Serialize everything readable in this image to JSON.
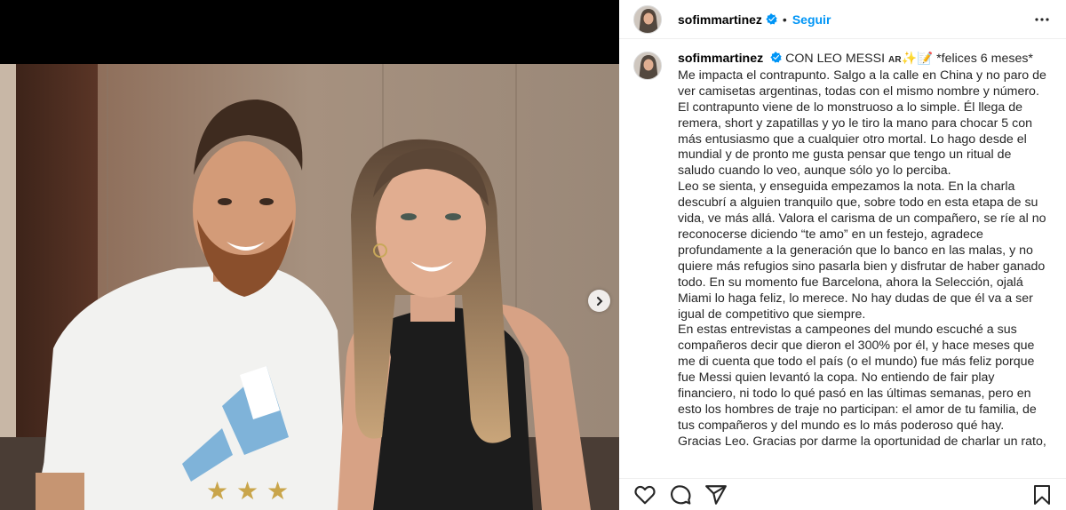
{
  "post": {
    "username": "sofimmartinez",
    "follow_label": "Seguir",
    "separator": "•",
    "caption_head": "CON LEO MESSI",
    "flag_text": "AR",
    "emoji": "✨📝",
    "caption_tail": " *felices 6 meses*",
    "paragraphs": [
      "Me impacta el contrapunto. Salgo a la calle en China y no paro de ver camisetas argentinas, todas con el mismo nombre y número.",
      "El contrapunto viene de lo monstruoso a lo simple. Él llega de remera, short y zapatillas y yo le tiro la mano para chocar 5 con más entusiasmo que a cualquier otro mortal. Lo hago desde el mundial y de pronto me gusta pensar que tengo un ritual de saludo cuando lo veo, aunque sólo yo lo perciba.",
      "Leo se sienta, y enseguida empezamos la nota. En la charla descubrí a alguien tranquilo que, sobre todo en esta etapa de su vida, ve más allá. Valora el carisma de un compañero, se ríe al no reconocerse diciendo “te amo” en un festejo, agradece profundamente a la generación que lo banco en las malas, y no quiere más refugios sino pasarla bien y disfrutar de haber ganado todo. En su momento fue Barcelona, ahora la Selección, ojalá Miami lo haga feliz, lo merece. No hay dudas de que él va a ser igual de competitivo que siempre.",
      "En estas entrevistas a campeones del mundo escuché a sus compañeros decir que dieron el 300% por él, y hace meses que me di cuenta que todo el país (o el mundo) fue más feliz porque fue Messi quien levantó la copa. No entiendo de fair play financiero, ni todo lo qué pasó en las últimas semanas, pero en esto los hombres de traje no participan: el amor de tu familia, de tus compañeros y del mundo es lo más poderoso qué hay.",
      "Gracias Leo. Gracias por darme la oportunidad de charlar un rato,"
    ]
  },
  "icons": {
    "verified": "verified-badge-icon",
    "more": "more-options-icon",
    "like": "heart-icon",
    "comment": "comment-icon",
    "share": "share-icon",
    "save": "bookmark-icon",
    "next": "chevron-right-icon"
  },
  "colors": {
    "accent": "#0095f6",
    "text": "#262626",
    "border": "#efefef"
  }
}
